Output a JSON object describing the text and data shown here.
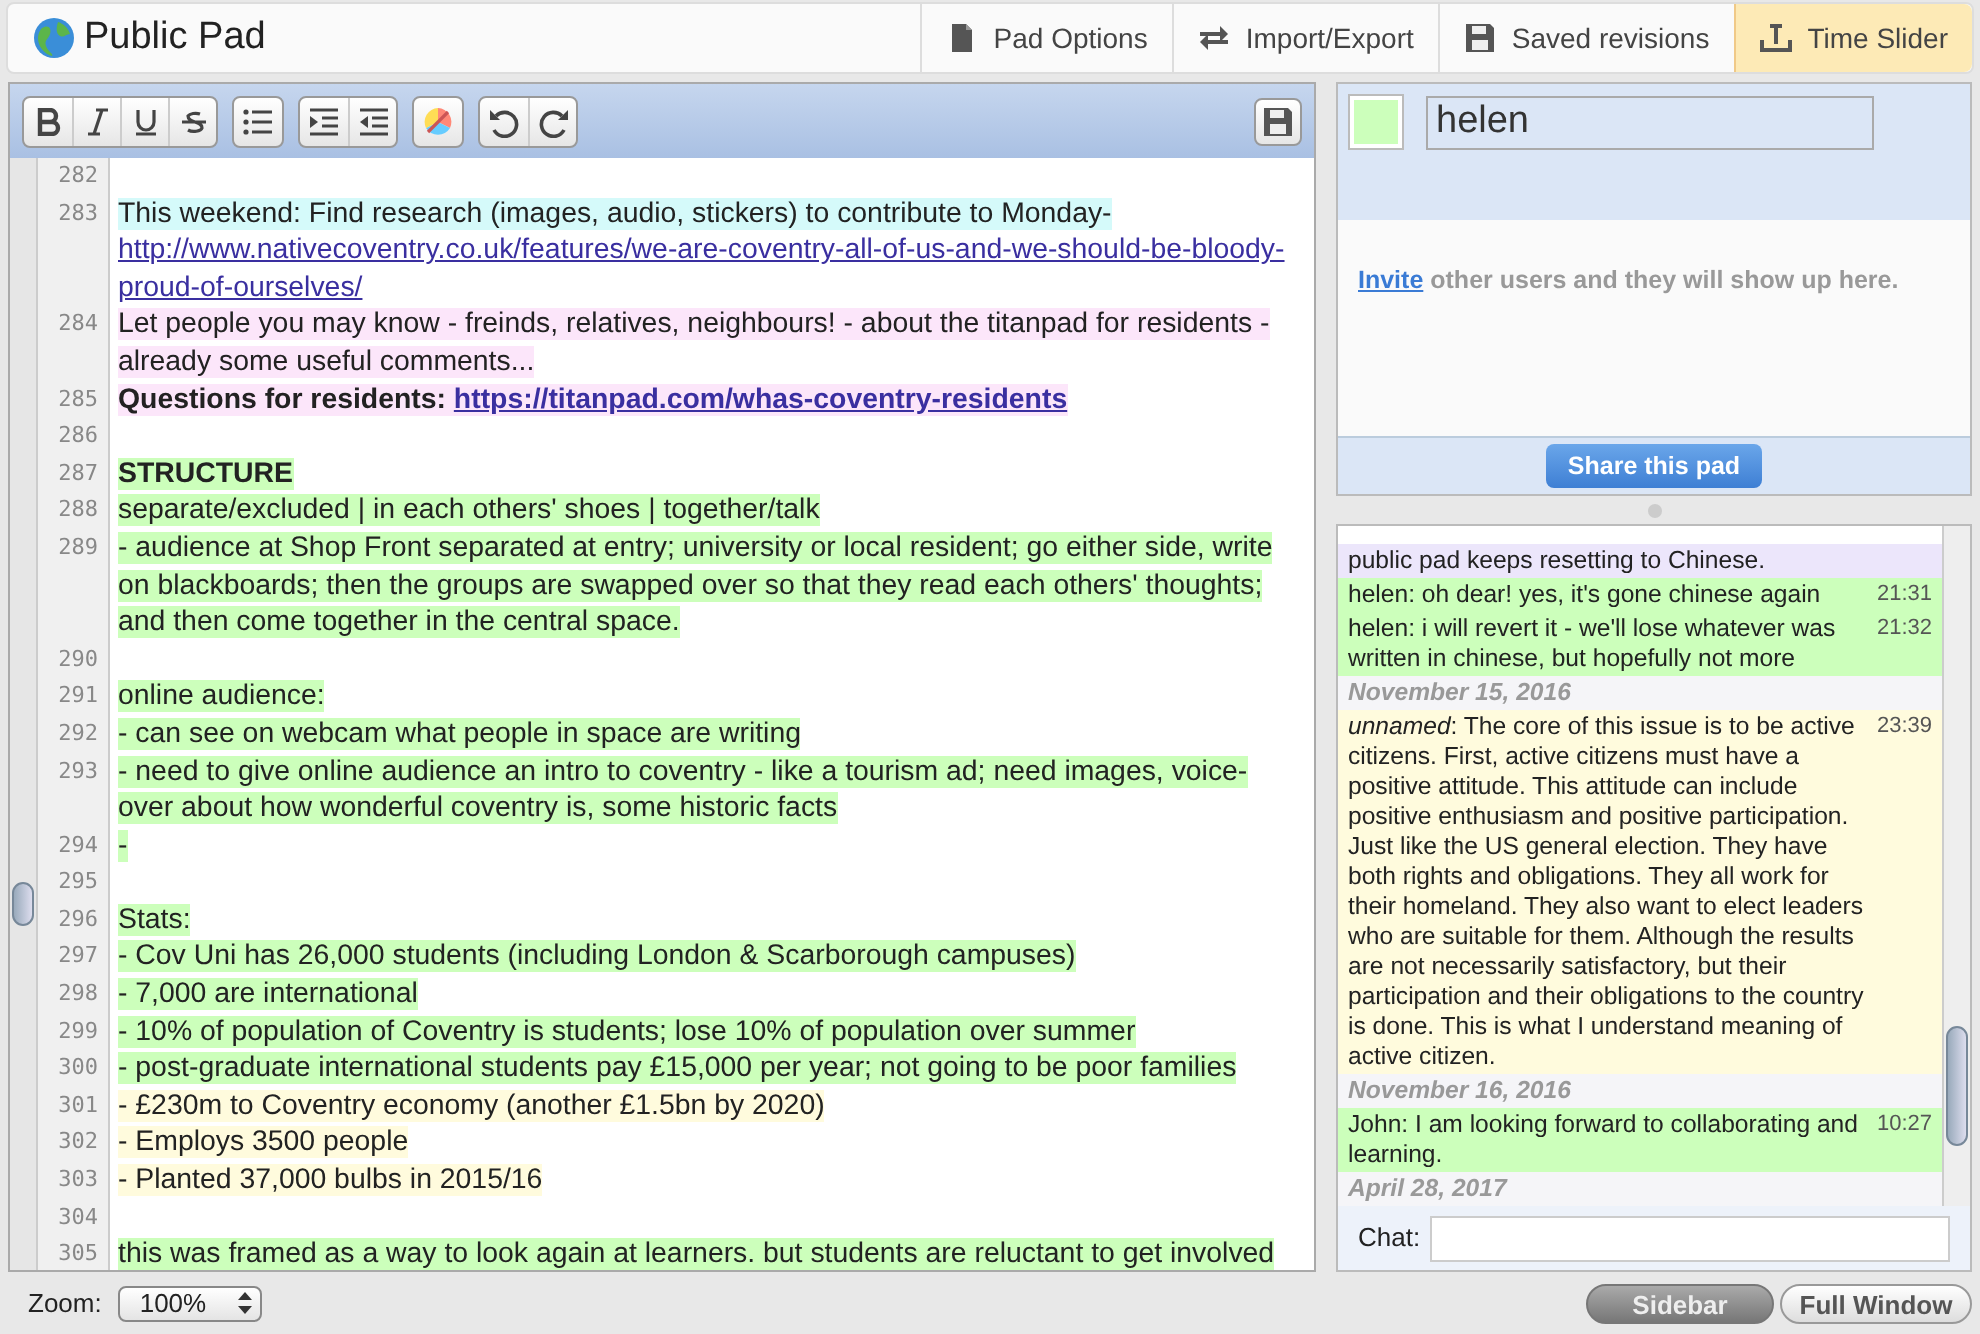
{
  "header": {
    "title": "Public Pad",
    "tabs": [
      {
        "label": "Pad Options",
        "selected": false
      },
      {
        "label": "Import/Export",
        "selected": false
      },
      {
        "label": "Saved revisions",
        "selected": false
      },
      {
        "label": "Time Slider",
        "selected": true
      }
    ]
  },
  "editor": {
    "lines": [
      {
        "number": "282"
      },
      {
        "number": "283",
        "color": "#d5fafa",
        "segments": [
          {
            "kind": "text",
            "text": "This weekend: Find research (images, audio, stickers) to contribute to Monday-"
          },
          {
            "kind": "link",
            "text": "http://www.nativecoventry.co.uk/features/we-are-coventry-all-of-us-and-we-should-be-bloody-proud-of-ourselves/"
          }
        ]
      },
      {
        "number": "284",
        "color": "#fce6fa",
        "segments": [
          {
            "kind": "text",
            "text": "Let people you may know - freinds, relatives, neighbours! - about the titanpad for residents - already some useful comments... "
          }
        ]
      },
      {
        "number": "285",
        "color": "#fce6fa",
        "segments": [
          {
            "kind": "bold",
            "text": "Questions for residents: "
          },
          {
            "kind": "boldlink",
            "text": "https://titanpad.com/whas-coventry-residents"
          }
        ]
      },
      {
        "number": "286"
      },
      {
        "number": "287",
        "color": "#ccffbb",
        "segments": [
          {
            "kind": "bold",
            "text": "STRUCTURE"
          }
        ]
      },
      {
        "number": "288",
        "color": "#ccffbb",
        "segments": [
          {
            "kind": "text",
            "text": "separate/excluded | in each others' shoes | together/talk"
          }
        ]
      },
      {
        "number": "289",
        "color": "#ccffbb",
        "segments": [
          {
            "kind": "text",
            "text": "- audience at Shop Front separated at entry; university or local resident; go either side, write on blackboards; then the groups are swapped over so that they read each others' thoughts; and then come together in the central space."
          }
        ]
      },
      {
        "number": "290"
      },
      {
        "number": "291",
        "color": "#ccffbb",
        "segments": [
          {
            "kind": "text",
            "text": "online audience: "
          }
        ]
      },
      {
        "number": "292",
        "color": "#ccffbb",
        "segments": [
          {
            "kind": "text",
            "text": "- can see on webcam what people in space are writing"
          }
        ]
      },
      {
        "number": "293",
        "color": "#ccffbb",
        "segments": [
          {
            "kind": "text",
            "text": "- need to give online audience an intro to coventry - like a tourism ad; need images, voice-over about how wonderful coventry is, some historic facts"
          }
        ]
      },
      {
        "number": "294",
        "color": "#ccffbb",
        "segments": [
          {
            "kind": "text",
            "text": "-"
          }
        ]
      },
      {
        "number": "295"
      },
      {
        "number": "296",
        "color": "#ccffbb",
        "segments": [
          {
            "kind": "text",
            "text": "Stats:"
          }
        ]
      },
      {
        "number": "297",
        "color": "#ccffbb",
        "segments": [
          {
            "kind": "text",
            "text": "- Cov Uni has 26,000 students (including London & Scarborough campuses)"
          }
        ]
      },
      {
        "number": "298",
        "color": "#ccffbb",
        "segments": [
          {
            "kind": "text",
            "text": "- 7,000 are international"
          }
        ]
      },
      {
        "number": "299",
        "color": "#ccffbb",
        "segments": [
          {
            "kind": "text",
            "text": "- 10% of population of Coventry is students; lose 10% of population over summer"
          }
        ]
      },
      {
        "number": "300",
        "color": "#ccffbb",
        "segments": [
          {
            "kind": "text",
            "text": "- post-graduate international students pay £15,000 per year; not going to be poor families"
          }
        ]
      },
      {
        "number": "301",
        "color": "#fffbdd",
        "segments": [
          {
            "kind": "text",
            "text": "- £230m to Coventry economy (another £1.5bn by 2020)"
          }
        ]
      },
      {
        "number": "302",
        "color": "#fffbdd",
        "segments": [
          {
            "kind": "text",
            "text": "- Employs 3500 people"
          }
        ]
      },
      {
        "number": "303",
        "color": "#fffbdd",
        "segments": [
          {
            "kind": "text",
            "text": "- Planted 37,000 bulbs in 2015/16"
          }
        ]
      },
      {
        "number": "304"
      },
      {
        "number": "305",
        "color": "#ccffbb",
        "segments": [
          {
            "kind": "text",
            "text": "this was framed as a way to look again at learners. but students are reluctant to get involved"
          }
        ]
      }
    ]
  },
  "zoom": {
    "label": "Zoom:",
    "value": "100%"
  },
  "users": {
    "color": "#ccffbb",
    "name": "helen",
    "invite_link": "Invite",
    "invite_text": " other users and they will show up here.",
    "share_button": "Share this pad"
  },
  "chat": {
    "items": [
      {
        "kind": "message",
        "color": "#ece6fb",
        "text": "public pad keeps resetting to Chinese."
      },
      {
        "kind": "message",
        "color": "#ccffbb",
        "text": "helen: oh dear! yes, it's gone chinese again",
        "time": "21:31"
      },
      {
        "kind": "message",
        "color": "#ccffbb",
        "text": "helen: i will revert it - we'll lose whatever was written in chinese, but hopefully not more",
        "time": "21:32"
      },
      {
        "kind": "date",
        "text": "November 15, 2016"
      },
      {
        "kind": "message",
        "color": "#fffbdd",
        "text": "*unnamed*: The core of this issue is to be active citizens. First, active citizens must have a positive attitude. This attitude can include positive enthusiasm and positive participation. Just like the US general election. They have both rights and obligations. They all work for their homeland. They also want to elect leaders who are suitable for them. Although the results are not necessarily satisfactory, but their participation and their obligations to the country is done. This is what I understand meaning of active citizen.",
        "time": "23:39"
      },
      {
        "kind": "date",
        "text": "November 16, 2016"
      },
      {
        "kind": "message",
        "color": "#ccffbb",
        "text": "John: I am looking forward to collaborating and learning.",
        "time": "10:27"
      },
      {
        "kind": "date",
        "text": "April 28, 2017"
      }
    ],
    "input_label": "Chat:"
  },
  "view_buttons": [
    {
      "label": "Sidebar",
      "selected": true
    },
    {
      "label": "Full Window",
      "selected": false
    }
  ]
}
